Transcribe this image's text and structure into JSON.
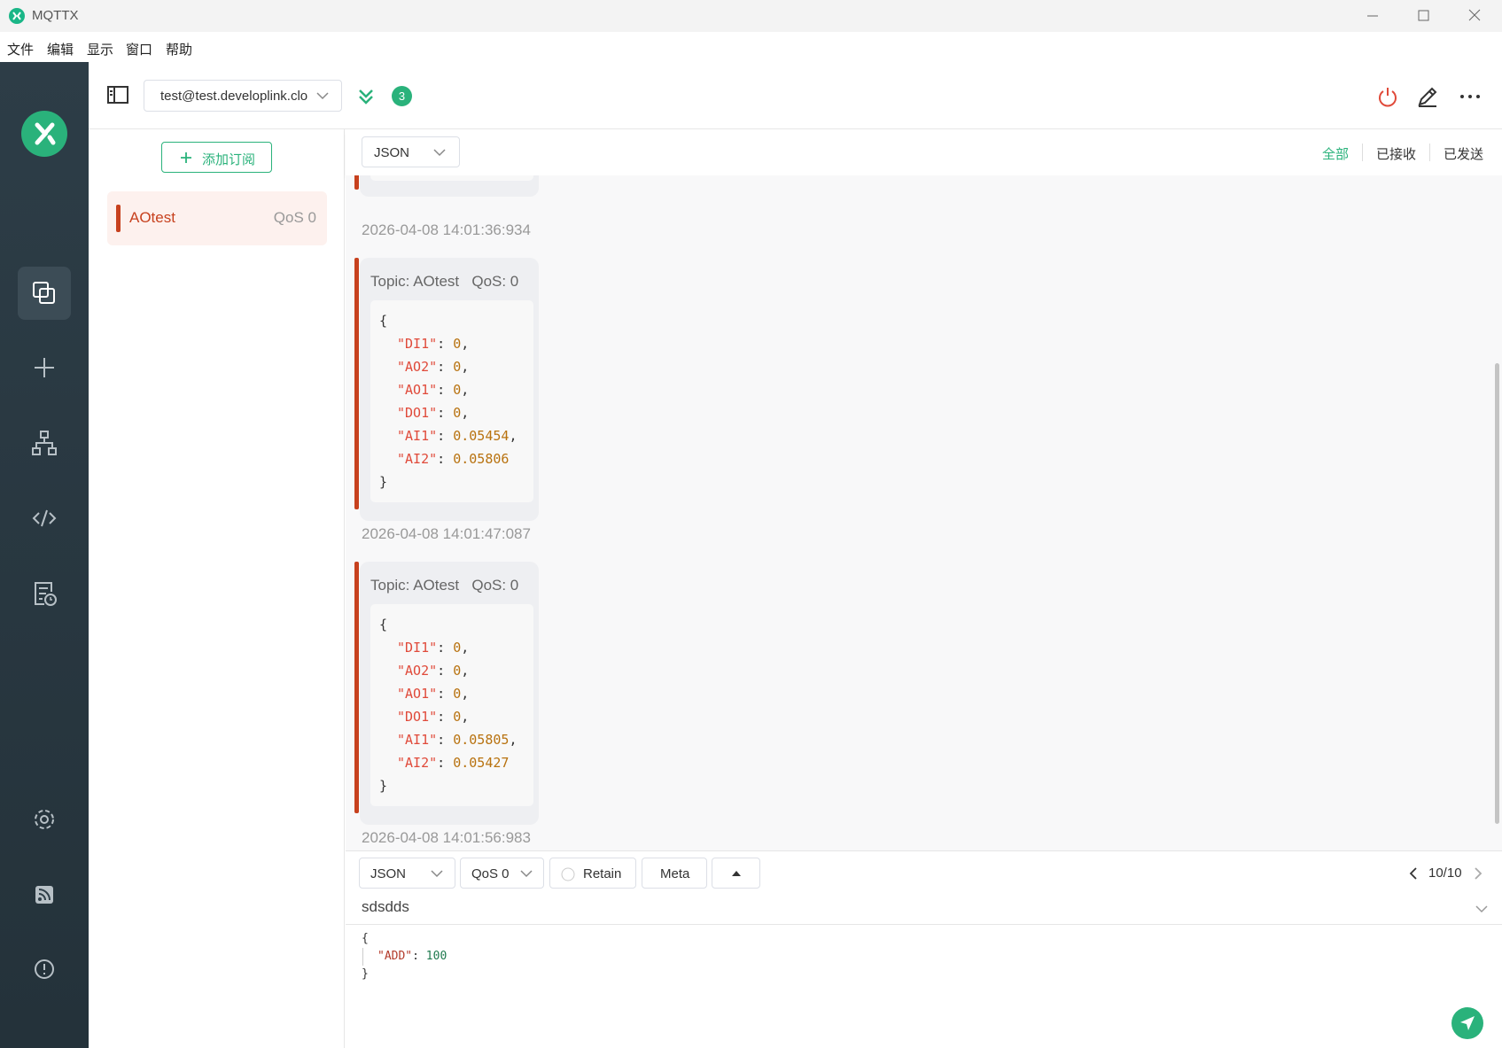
{
  "app": {
    "title": "MQTTX"
  },
  "menu": [
    "文件",
    "编辑",
    "显示",
    "窗口",
    "帮助"
  ],
  "header": {
    "connection": "test@test.developlink.clo",
    "badge_count": "3"
  },
  "subscriptions": {
    "add_label": "添加订阅",
    "items": [
      {
        "topic": "AOtest",
        "qos": "QoS 0",
        "color": "#c7411e"
      }
    ]
  },
  "messages": {
    "format": "JSON",
    "filters": [
      "全部",
      "已接收",
      "已发送"
    ],
    "partial_time": "2026-04-08 14:01:36:934",
    "items": [
      {
        "topic": "Topic: AOtest",
        "qos": "QoS: 0",
        "payload": [
          [
            "DI1",
            "0"
          ],
          [
            "AO2",
            "0"
          ],
          [
            "AO1",
            "0"
          ],
          [
            "DO1",
            "0"
          ],
          [
            "AI1",
            "0.05454"
          ],
          [
            "AI2",
            "0.05806"
          ]
        ],
        "time": "2026-04-08 14:01:47:087"
      },
      {
        "topic": "Topic: AOtest",
        "qos": "QoS: 0",
        "payload": [
          [
            "DI1",
            "0"
          ],
          [
            "AO2",
            "0"
          ],
          [
            "AO1",
            "0"
          ],
          [
            "DO1",
            "0"
          ],
          [
            "AI1",
            "0.05805"
          ],
          [
            "AI2",
            "0.05427"
          ]
        ],
        "time": "2026-04-08 14:01:56:983"
      }
    ]
  },
  "composer": {
    "format": "JSON",
    "qos": "QoS 0",
    "retain": "Retain",
    "meta": "Meta",
    "pagination": "10/10",
    "topic": "sdsdds",
    "payload_open": "{",
    "payload_key": "\"ADD\"",
    "payload_value": "100",
    "payload_close": "}"
  },
  "colors": {
    "accent": "#2ab27b",
    "topic": "#c7411e",
    "sidebar": "#2d3d47"
  }
}
